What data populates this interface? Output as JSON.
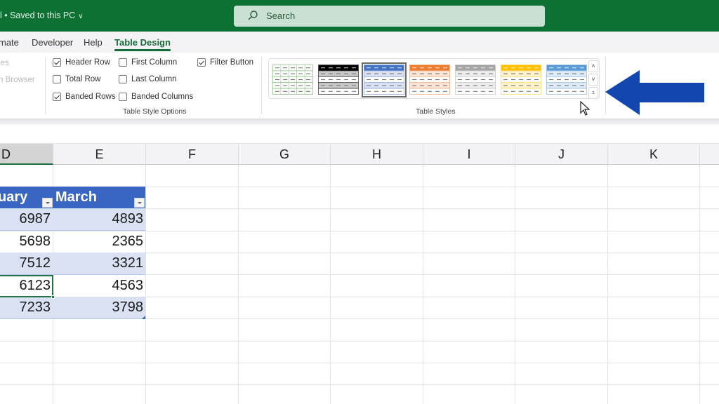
{
  "titlebar": {
    "file_status": "l • Saved to this PC",
    "status_chevron": "∨",
    "search_placeholder": "Search"
  },
  "tabs": [
    {
      "label": "mate",
      "active": false
    },
    {
      "label": "Developer",
      "active": false
    },
    {
      "label": "Help",
      "active": false
    },
    {
      "label": "Table Design",
      "active": true
    }
  ],
  "ribbon": {
    "properties_group": {
      "items": [
        "ies",
        "n Browser"
      ]
    },
    "table_style_options": {
      "label": "Table Style Options",
      "options": [
        {
          "label": "Header Row",
          "checked": true
        },
        {
          "label": "Total Row",
          "checked": false
        },
        {
          "label": "Banded Rows",
          "checked": true
        },
        {
          "label": "First Column",
          "checked": false
        },
        {
          "label": "Last Column",
          "checked": false
        },
        {
          "label": "Banded Columns",
          "checked": false
        },
        {
          "label": "Filter Button",
          "checked": true
        }
      ]
    },
    "table_styles": {
      "label": "Table Styles",
      "styles": [
        {
          "name": "green-light",
          "header": "#ffffff",
          "band": "#ffffff",
          "line": "#8cc084",
          "selected": false
        },
        {
          "name": "black-medium",
          "header": "#000000",
          "band": "#c8c8c8",
          "line": "#444444",
          "selected": false
        },
        {
          "name": "blue-medium",
          "header": "#4472c4",
          "band": "#d9e1f2",
          "line": "#8ea9db",
          "selected": true
        },
        {
          "name": "orange-medium",
          "header": "#ed7d31",
          "band": "#fce4d6",
          "line": "#f4b084",
          "selected": false
        },
        {
          "name": "gray-medium",
          "header": "#a5a5a5",
          "band": "#ededed",
          "line": "#c9c9c9",
          "selected": false
        },
        {
          "name": "gold-medium",
          "header": "#ffc000",
          "band": "#fff2cc",
          "line": "#ffd966",
          "selected": false
        },
        {
          "name": "lightblue-medium",
          "header": "#5b9bd5",
          "band": "#ddebf7",
          "line": "#9bc2e6",
          "selected": false
        }
      ],
      "scroll_up": "˄",
      "scroll_down": "˅",
      "more": "⩡"
    }
  },
  "annotation": {
    "arrow_color": "#1446b0"
  },
  "sheet": {
    "columns": [
      "D",
      "E",
      "F",
      "G",
      "H",
      "I",
      "J",
      "K"
    ],
    "selected_column": "D",
    "table": {
      "headers": [
        "uary",
        "March"
      ],
      "rows": [
        [
          "6987",
          "4893"
        ],
        [
          "5698",
          "2365"
        ],
        [
          "7512",
          "3321"
        ],
        [
          "6123",
          "4563"
        ],
        [
          "7233",
          "3798"
        ]
      ],
      "header_color": "#3966c2",
      "band_color": "#d9e1f2"
    }
  }
}
